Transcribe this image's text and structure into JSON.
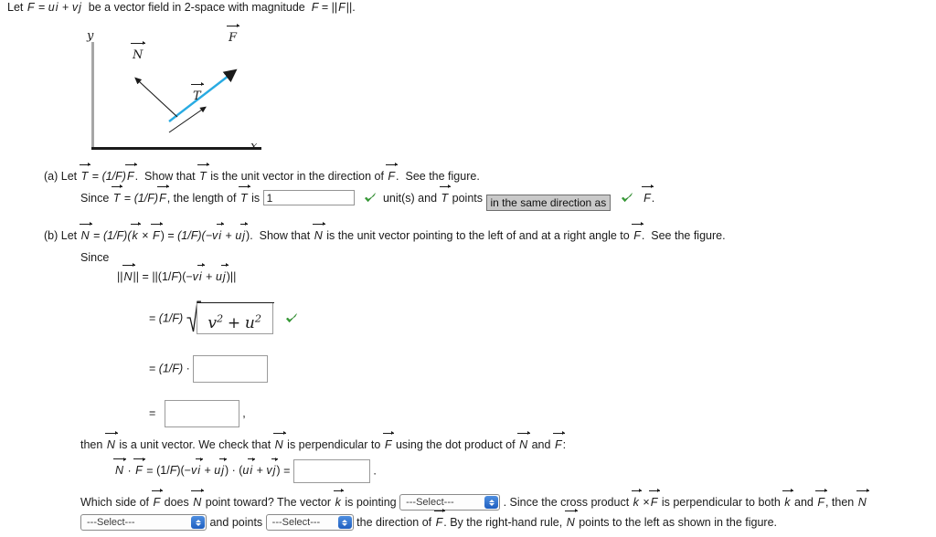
{
  "problem": {
    "intro": {
      "prefix": "Let",
      "eq": "=",
      "F": "F",
      "ui": "u",
      "i": "i",
      "plus": "+",
      "vj": "v",
      "j": "j",
      "middle": "be a vector field in 2-space with magnitude",
      "mag_lhs": "F",
      "mag_eq": "=",
      "mag_rhs": "||F||",
      "period": "."
    },
    "figure": {
      "y_axis_label": "y",
      "x_axis_label": "x",
      "vector_F_label": "F",
      "vector_N_label": "N",
      "vector_T_label": "T",
      "vector_F_color": "#29abe2",
      "vector_N_color": "#1a1a1a",
      "vector_T_color": "#1a1a1a",
      "y_axis_color": "#a6a6a6",
      "x_axis_color": "#1a1a1a"
    },
    "part_a": {
      "label": "(a)",
      "text_1": "Let",
      "T": "T",
      "eq": "=",
      "expr": "(1/F)",
      "F": "F",
      "text_2": "Show that",
      "text_3": "is the unit vector in the direction of",
      "text_4": "See the figure.",
      "period": ".",
      "sub_since": "Since",
      "sub_text_1": ", the length of",
      "sub_text_2": "is",
      "answer_value": "1",
      "units_text": "unit(s) and",
      "points_text": "points",
      "dropdown_selected": "in the same direction as",
      "trailing_F": "F",
      "trailing_period": ".",
      "check_icon": "green-check-icon"
    },
    "part_b": {
      "label": "(b)",
      "text_1": "Let",
      "N": "N",
      "eq1": "=",
      "expr1": "(1/F)(",
      "k": "k",
      "cross": "×",
      "F": "F",
      "close1": ")",
      "eq2": "=",
      "expr2": "(1/F)(−",
      "v": "v",
      "i": "i",
      "plus": "+",
      "u": "u",
      "j": "j",
      "close2": ").",
      "text_2": "Show that",
      "text_3": "is the unit vector pointing to the left of and at a right angle to",
      "text_4": "See the figure.",
      "since": "Since",
      "eq_line_1": {
        "lhs": "||N||",
        "eq": "=",
        "rhs": "||(1/F)(−vi + uj)||"
      },
      "eq_line_2": {
        "eq": "=",
        "coef": "(1/F)",
        "radicand_v": "v",
        "radicand_exp1": "2",
        "radicand_plus": "+",
        "radicand_u": "u",
        "radicand_exp2": "2",
        "check_icon": "green-check-icon"
      },
      "eq_line_3": {
        "eq": "=",
        "coef": "(1/F)",
        "dot": "·",
        "answer_value": ""
      },
      "eq_line_4": {
        "eq": "=",
        "answer_value": "",
        "comma": ","
      },
      "then_line": {
        "part_1": "then",
        "N": "N",
        "part_2": "is a unit vector. We check that",
        "part_3": "is perpendicular to",
        "F": "F",
        "part_4": "using the dot product of",
        "part_5": "and",
        "colon": ":"
      },
      "dot_eq": {
        "N": "N",
        "dot": "·",
        "F": "F",
        "eq1": "=",
        "expr": "(1/F)(−vi + uj) · (ui + vj)",
        "eq2": "=",
        "answer_value": "",
        "period": "."
      },
      "which_line": {
        "part_1": "Which side of",
        "F": "F",
        "part_2": "does",
        "N": "N",
        "part_3": "point toward? The vector",
        "k": "k",
        "part_4": "is pointing",
        "dropdown_1": "---Select---",
        "part_5": ". Since the cross product",
        "cross": "×",
        "part_6": "is perpendicular to both",
        "part_7": "and",
        "part_8": ", then"
      },
      "last_line": {
        "dropdown_2": "---Select---",
        "part_1": "and points",
        "dropdown_3": "---Select---",
        "part_2": "the direction of",
        "F": "F",
        "part_3": ". By the right-hand rule,",
        "N": "N",
        "part_4": "points to the left as shown in the figure."
      }
    },
    "colors": {
      "check_green": "#3aa83a",
      "dropdown_blue": "#2f6fd0",
      "filled_select_bg": "#c9c9c9",
      "vector_blue": "#29abe2"
    }
  }
}
